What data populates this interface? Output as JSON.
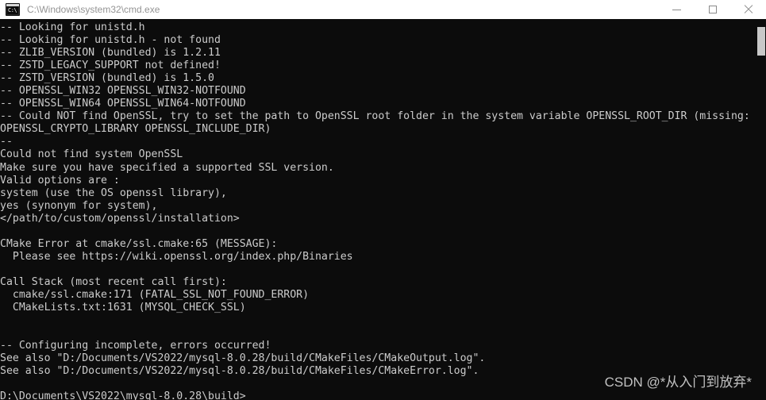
{
  "window": {
    "title": "C:\\Windows\\system32\\cmd.exe",
    "icon_name": "cmd-icon",
    "icon_text": "C:\\",
    "background_color": "#0c0c0c",
    "titlebar_color": "#ffffff",
    "text_color": "#cccccc"
  },
  "controls": {
    "minimize_label": "—",
    "maximize_label": "□",
    "close_label": "×"
  },
  "console": {
    "lines": [
      "-- Looking for unistd.h",
      "-- Looking for unistd.h - not found",
      "-- ZLIB_VERSION (bundled) is 1.2.11",
      "-- ZSTD_LEGACY_SUPPORT not defined!",
      "-- ZSTD_VERSION (bundled) is 1.5.0",
      "-- OPENSSL_WIN32 OPENSSL_WIN32-NOTFOUND",
      "-- OPENSSL_WIN64 OPENSSL_WIN64-NOTFOUND",
      "-- Could NOT find OpenSSL, try to set the path to OpenSSL root folder in the system variable OPENSSL_ROOT_DIR (missing:",
      "OPENSSL_CRYPTO_LIBRARY OPENSSL_INCLUDE_DIR)",
      "--",
      "Could not find system OpenSSL",
      "Make sure you have specified a supported SSL version.",
      "Valid options are :",
      "system (use the OS openssl library),",
      "yes (synonym for system),",
      "</path/to/custom/openssl/installation>",
      "",
      "CMake Error at cmake/ssl.cmake:65 (MESSAGE):",
      "  Please see https://wiki.openssl.org/index.php/Binaries",
      "",
      "Call Stack (most recent call first):",
      "  cmake/ssl.cmake:171 (FATAL_SSL_NOT_FOUND_ERROR)",
      "  CMakeLists.txt:1631 (MYSQL_CHECK_SSL)",
      "",
      "",
      "-- Configuring incomplete, errors occurred!",
      "See also \"D:/Documents/VS2022/mysql-8.0.28/build/CMakeFiles/CMakeOutput.log\".",
      "See also \"D:/Documents/VS2022/mysql-8.0.28/build/CMakeFiles/CMakeError.log\".",
      "",
      "D:\\Documents\\VS2022\\mysql-8.0.28\\build>"
    ]
  },
  "watermark": {
    "text": "CSDN @*从入门到放弃*"
  }
}
